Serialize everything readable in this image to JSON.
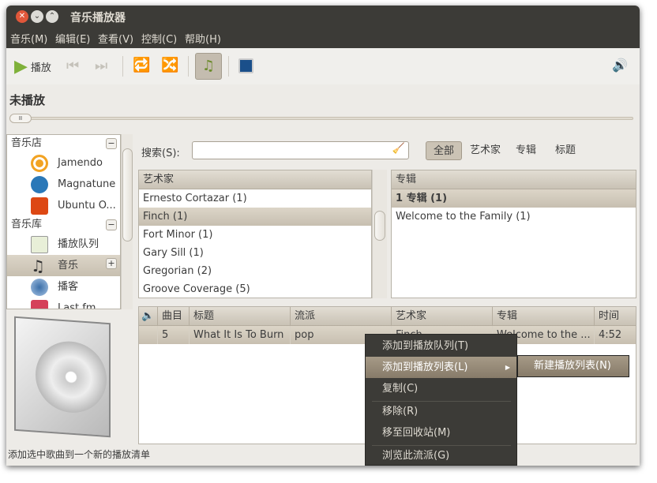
{
  "window": {
    "title": "音乐播放器"
  },
  "menubar": [
    "音乐(M)",
    "编辑(E)",
    "查看(V)",
    "控制(C)",
    "帮助(H)"
  ],
  "toolbar": {
    "play_label": "播放"
  },
  "now_playing": "未播放",
  "sidebar": {
    "sections": [
      {
        "label": "音乐店",
        "toggle": "−",
        "items": [
          {
            "label": "Jamendo"
          },
          {
            "label": "Magnatune"
          },
          {
            "label": "Ubuntu O..."
          }
        ]
      },
      {
        "label": "音乐库",
        "toggle": "−",
        "items": [
          {
            "label": "播放队列"
          },
          {
            "label": "音乐",
            "toggle": "+"
          },
          {
            "label": "播客"
          },
          {
            "label": "Last.fm"
          }
        ]
      }
    ]
  },
  "search": {
    "label": "搜索(S):",
    "value": "",
    "filters": [
      "全部",
      "艺术家",
      "专辑",
      "标题"
    ],
    "active_filter": "全部"
  },
  "artists": {
    "header": "艺术家",
    "rows": [
      "Ernesto Cortazar (1)",
      "Finch (1)",
      "Fort Minor (1)",
      "Gary Sill (1)",
      "Gregorian (2)",
      "Groove Coverage (5)"
    ],
    "selected": 1
  },
  "albums": {
    "header": "专辑",
    "rows": [
      "1 专辑 (1)",
      "Welcome to the Family (1)"
    ],
    "selected": 0
  },
  "tracks": {
    "columns": [
      "曲目",
      "标题",
      "流派",
      "艺术家",
      "专辑",
      "时间"
    ],
    "rows": [
      {
        "track": "5",
        "title": "What It Is To Burn",
        "genre": "pop",
        "artist": "Finch",
        "album": "Welcome to the ...",
        "time": "4:52"
      }
    ]
  },
  "context_menu": {
    "items": [
      "添加到播放队列(T)",
      "添加到播放列表(L)",
      "复制(C)",
      "移除(R)",
      "移至回收站(M)",
      "浏览此流派(G)"
    ],
    "highlighted": 1,
    "submenu": [
      "新建播放列表(N)"
    ]
  },
  "status": "添加选中歌曲到一个新的播放清单"
}
